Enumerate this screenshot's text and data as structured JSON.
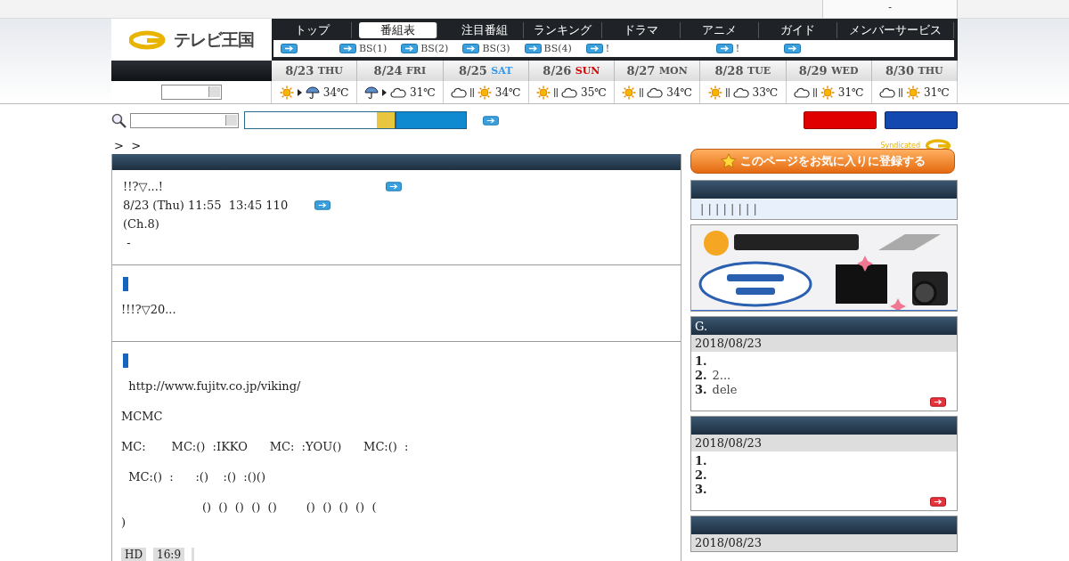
{
  "top_bar": {
    "text": "-"
  },
  "logo": {
    "text": "テレビ王国"
  },
  "nav": {
    "tabs": [
      {
        "label": "トップ",
        "selected": false
      },
      {
        "label": "番組表",
        "selected": true
      },
      {
        "label": "注目番組",
        "selected": false
      },
      {
        "label": "ランキング",
        "selected": false
      },
      {
        "label": "ドラマ",
        "selected": false
      },
      {
        "label": "アニメ",
        "selected": false
      },
      {
        "label": "ガイド",
        "selected": false
      },
      {
        "label": "メンバーサービス",
        "selected": false
      }
    ],
    "sublinks": [
      {
        "kind": "icon"
      },
      {
        "kind": "link",
        "label": "BS(1)"
      },
      {
        "kind": "link",
        "label": "BS(2)"
      },
      {
        "kind": "link",
        "label": "BS(3)"
      },
      {
        "kind": "link",
        "label": "BS(4)"
      },
      {
        "kind": "link",
        "label": "!"
      },
      {
        "kind": "link",
        "label": "!"
      },
      {
        "kind": "icon"
      }
    ]
  },
  "days": [
    {
      "date": "8/23",
      "weekday": "THU",
      "kind": "weekday",
      "weather": [
        {
          "kind": "sun"
        },
        {
          "kind": "then"
        },
        {
          "kind": "rain"
        }
      ],
      "temp": "34℃"
    },
    {
      "date": "8/24",
      "weekday": "FRI",
      "kind": "weekday",
      "weather": [
        {
          "kind": "rain"
        },
        {
          "kind": "then"
        },
        {
          "kind": "cloud"
        }
      ],
      "temp": "31℃"
    },
    {
      "date": "8/25",
      "weekday": "SAT",
      "kind": "saturday",
      "weather": [
        {
          "kind": "cloud"
        },
        {
          "kind": "or"
        },
        {
          "kind": "sun"
        }
      ],
      "temp": "34℃"
    },
    {
      "date": "8/26",
      "weekday": "SUN",
      "kind": "sunday",
      "weather": [
        {
          "kind": "sun"
        },
        {
          "kind": "or"
        },
        {
          "kind": "cloud"
        }
      ],
      "temp": "35℃"
    },
    {
      "date": "8/27",
      "weekday": "MON",
      "kind": "weekday",
      "weather": [
        {
          "kind": "sun"
        },
        {
          "kind": "or"
        },
        {
          "kind": "cloud"
        }
      ],
      "temp": "34℃"
    },
    {
      "date": "8/28",
      "weekday": "TUE",
      "kind": "weekday",
      "weather": [
        {
          "kind": "sun"
        },
        {
          "kind": "or"
        },
        {
          "kind": "cloud"
        }
      ],
      "temp": "33℃"
    },
    {
      "date": "8/29",
      "weekday": "WED",
      "kind": "weekday",
      "weather": [
        {
          "kind": "cloud"
        },
        {
          "kind": "or"
        },
        {
          "kind": "sun"
        }
      ],
      "temp": "31℃"
    },
    {
      "date": "8/30",
      "weekday": "THU",
      "kind": "weekday",
      "weather": [
        {
          "kind": "cloud"
        },
        {
          "kind": "or"
        },
        {
          "kind": "sun"
        }
      ],
      "temp": "31℃"
    }
  ],
  "breadcrumb": ">  >",
  "syndicated": "Syndicated",
  "sections": [
    {
      "kind": "info",
      "lines": [
        {
          "text": "!!?▽...!",
          "link": true
        },
        {
          "text": "8/23 (Thu) 11:55  13:45 110",
          "link": true
        },
        {
          "text": "(Ch.8)",
          "link": false
        },
        {
          "text": " -",
          "link": false
        }
      ]
    },
    {
      "kind": "marked",
      "paragraphs": [
        "!!!?▽20..."
      ]
    },
    {
      "kind": "marked",
      "paragraphs": [
        "  http://www.fujitv.co.jp/viking/",
        "MCMC",
        "MC:       MC:()  :IKKO      MC:  :YOU()      MC:()  :",
        "  MC:()  :      :()    :()  :()()",
        "                      ()  ()  ()  ()  ()        ()  ()  ()  ()  (\n)"
      ],
      "tags": [
        {
          "kind": "text",
          "label": "HD"
        },
        {
          "kind": "text",
          "label": "16:9"
        },
        {
          "kind": "blank"
        }
      ]
    }
  ],
  "favorite_button": "このページをお気に入りに登録する",
  "links_panel": {
    "text": "| | | | | | | |"
  },
  "rankings": [
    {
      "title": "G.",
      "date": "2018/08/23",
      "items": [
        {
          "num": "1."
        },
        {
          "num": "2.",
          "text": "2..."
        },
        {
          "num": "3.",
          "text": "dele"
        }
      ]
    },
    {
      "date": "2018/08/23",
      "items": [
        {
          "num": "1."
        },
        {
          "num": "2."
        },
        {
          "num": "3."
        }
      ]
    },
    {
      "date": "2018/08/23"
    }
  ]
}
